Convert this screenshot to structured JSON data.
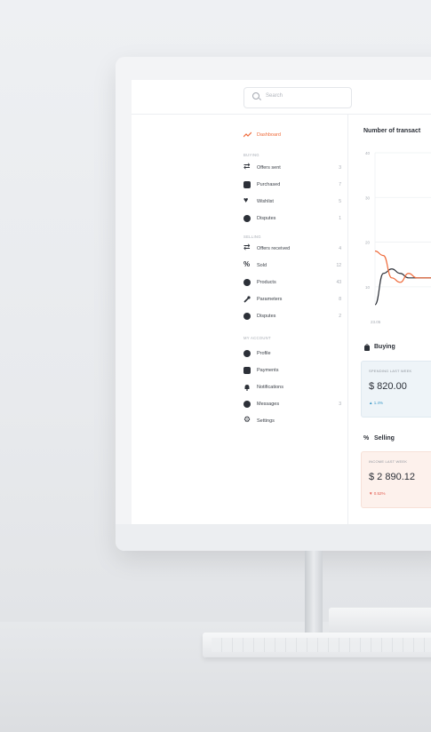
{
  "search": {
    "placeholder": "Search"
  },
  "nav": {
    "dashboard": "Dashboard",
    "buying_header": "BUYING",
    "buying": [
      {
        "label": "Offers sent",
        "count": "3"
      },
      {
        "label": "Purchased",
        "count": "7"
      },
      {
        "label": "Wishlist",
        "count": "5"
      },
      {
        "label": "Disputes",
        "count": "1"
      }
    ],
    "selling_header": "SELLING",
    "selling": [
      {
        "label": "Offers received",
        "count": "4"
      },
      {
        "label": "Sold",
        "count": "12"
      },
      {
        "label": "Products",
        "count": "43"
      },
      {
        "label": "Parameters",
        "count": "8"
      },
      {
        "label": "Disputes",
        "count": "2"
      }
    ],
    "account_header": "MY ACCOUNT",
    "account": [
      {
        "label": "Profile",
        "count": ""
      },
      {
        "label": "Payments",
        "count": ""
      },
      {
        "label": "Notifications",
        "count": ""
      },
      {
        "label": "Messages",
        "count": "3"
      },
      {
        "label": "Settings",
        "count": ""
      }
    ]
  },
  "chart_data": {
    "type": "line",
    "title": "Number of transact",
    "y_ticks": [
      "40",
      "30",
      "20",
      "10"
    ],
    "x_ticks": [
      "23.05"
    ],
    "ylim": [
      5,
      40
    ],
    "x": [
      0,
      1,
      2,
      3,
      4,
      5,
      6,
      7
    ],
    "series": [
      {
        "values": [
          6,
          13,
          14,
          13,
          12,
          12,
          12,
          12
        ],
        "color": "#2c3038"
      },
      {
        "values": [
          18,
          17,
          12,
          11,
          13,
          12,
          12,
          12
        ],
        "color": "#ef6a3a"
      }
    ]
  },
  "buying_section": {
    "title": "Buying",
    "card_label": "SPENDING LAST WEEK",
    "card_value": "$ 820.00",
    "card_change": "▲ 1.4%"
  },
  "selling_section": {
    "title": "Selling",
    "card_label": "INCOME LAST WEEK",
    "card_value": "$ 2 890.12",
    "card_change": "▼ 0.52%"
  },
  "colors": {
    "accent": "#ef6a3a",
    "up": "#3a98c7",
    "down": "#e2574c"
  }
}
